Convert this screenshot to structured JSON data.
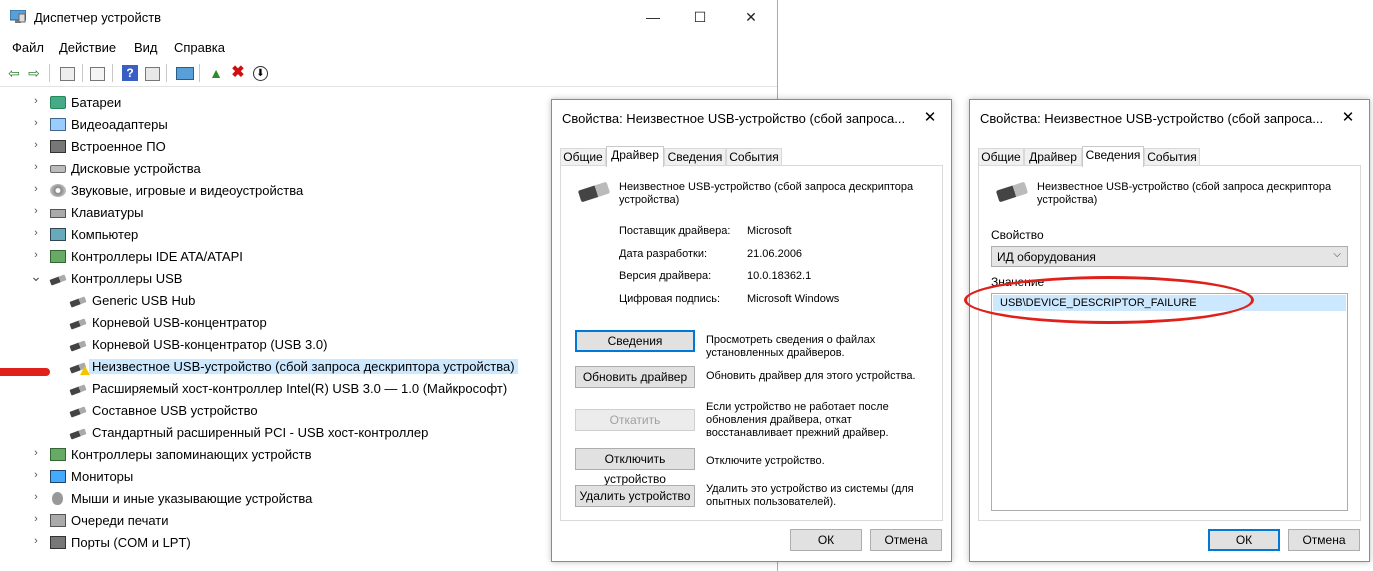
{
  "colors": {
    "accent": "#0078d7",
    "selection": "#cce8ff",
    "annotation": "#e0201a"
  },
  "main": {
    "title": "Диспетчер устройств",
    "caption": {
      "minimize": "—",
      "maximize": "☐",
      "close": "✕"
    },
    "menu": [
      "Файл",
      "Действие",
      "Вид",
      "Справка"
    ],
    "toolbar_icons": [
      "back-icon",
      "forward-icon",
      "properties-icon",
      "show-hide-icon",
      "help-icon",
      "view-icon",
      "monitor-icon",
      "update-driver-icon",
      "uninstall-icon",
      "scan-icon"
    ],
    "tree": [
      {
        "label": "Батареи",
        "arrow": "›",
        "icon": "battery-icon"
      },
      {
        "label": "Видеоадаптеры",
        "arrow": "›",
        "icon": "display-adapter-icon"
      },
      {
        "label": "Встроенное ПО",
        "arrow": "›",
        "icon": "firmware-icon"
      },
      {
        "label": "Дисковые устройства",
        "arrow": "›",
        "icon": "disk-drive-icon"
      },
      {
        "label": "Звуковые, игровые и видеоустройства",
        "arrow": "›",
        "icon": "speaker-icon"
      },
      {
        "label": "Клавиатуры",
        "arrow": "›",
        "icon": "keyboard-icon"
      },
      {
        "label": "Компьютер",
        "arrow": "›",
        "icon": "computer-icon"
      },
      {
        "label": "Контроллеры IDE ATA/ATAPI",
        "arrow": "›",
        "icon": "ide-controller-icon"
      },
      {
        "label": "Контроллеры USB",
        "arrow": "⌄",
        "icon": "usb-controller-icon"
      },
      {
        "label": "Generic USB Hub",
        "icon": "usb-plug-icon"
      },
      {
        "label": "Корневой USB-концентратор",
        "icon": "usb-plug-icon"
      },
      {
        "label": "Корневой USB-концентратор (USB 3.0)",
        "icon": "usb-plug-icon"
      },
      {
        "label": "Неизвестное USB-устройство (сбой запроса дескриптора устройства)",
        "icon": "usb-warning-icon",
        "selected": true
      },
      {
        "label": "Расширяемый хост-контроллер Intel(R) USB 3.0 — 1.0 (Майкрософт)",
        "icon": "usb-plug-icon"
      },
      {
        "label": "Составное USB устройство",
        "icon": "usb-plug-icon"
      },
      {
        "label": "Стандартный расширенный PCI - USB хост-контроллер",
        "icon": "usb-plug-icon"
      },
      {
        "label": "Контроллеры запоминающих устройств",
        "arrow": "›",
        "icon": "storage-controller-icon"
      },
      {
        "label": "Мониторы",
        "arrow": "›",
        "icon": "monitor-icon"
      },
      {
        "label": "Мыши и иные указывающие устройства",
        "arrow": "›",
        "icon": "mouse-icon"
      },
      {
        "label": "Очереди печати",
        "arrow": "›",
        "icon": "printer-icon"
      },
      {
        "label": "Порты (COM и LPT)",
        "arrow": "›",
        "icon": "port-icon"
      }
    ]
  },
  "dialog_driver": {
    "title": "Свойства: Неизвестное USB-устройство (сбой запроса...",
    "close": "✕",
    "tabs": [
      "Общие",
      "Драйвер",
      "Сведения",
      "События"
    ],
    "active_tab": "Драйвер",
    "device_name": "Неизвестное USB-устройство (сбой запроса дескриптора устройства)",
    "info": [
      {
        "k": "Поставщик драйвера:",
        "v": "Microsoft"
      },
      {
        "k": "Дата разработки:",
        "v": "21.06.2006"
      },
      {
        "k": "Версия драйвера:",
        "v": "10.0.18362.1"
      },
      {
        "k": "Цифровая подпись:",
        "v": "Microsoft Windows"
      }
    ],
    "buttons": [
      {
        "label": "Сведения",
        "desc": "Просмотреть сведения о файлах установленных драйверов."
      },
      {
        "label": "Обновить драйвер",
        "desc": "Обновить драйвер для этого устройства."
      },
      {
        "label": "Откатить",
        "desc": "Если устройство не работает после обновления драйвера, откат восстанавливает прежний драйвер."
      },
      {
        "label": "Отключить устройство",
        "desc": "Отключите устройство."
      },
      {
        "label": "Удалить устройство",
        "desc": "Удалить это устройство из системы (для опытных пользователей)."
      }
    ],
    "ok": "ОК",
    "cancel": "Отмена"
  },
  "dialog_details": {
    "title": "Свойства: Неизвестное USB-устройство (сбой запроса...",
    "close": "✕",
    "tabs": [
      "Общие",
      "Драйвер",
      "Сведения",
      "События"
    ],
    "active_tab": "Сведения",
    "device_name": "Неизвестное USB-устройство (сбой запроса дескриптора устройства)",
    "property_label": "Свойство",
    "property_value": "ИД оборудования",
    "value_label": "Значение",
    "values": [
      "USB\\DEVICE_DESCRIPTOR_FAILURE"
    ],
    "ok": "ОК",
    "cancel": "Отмена"
  }
}
